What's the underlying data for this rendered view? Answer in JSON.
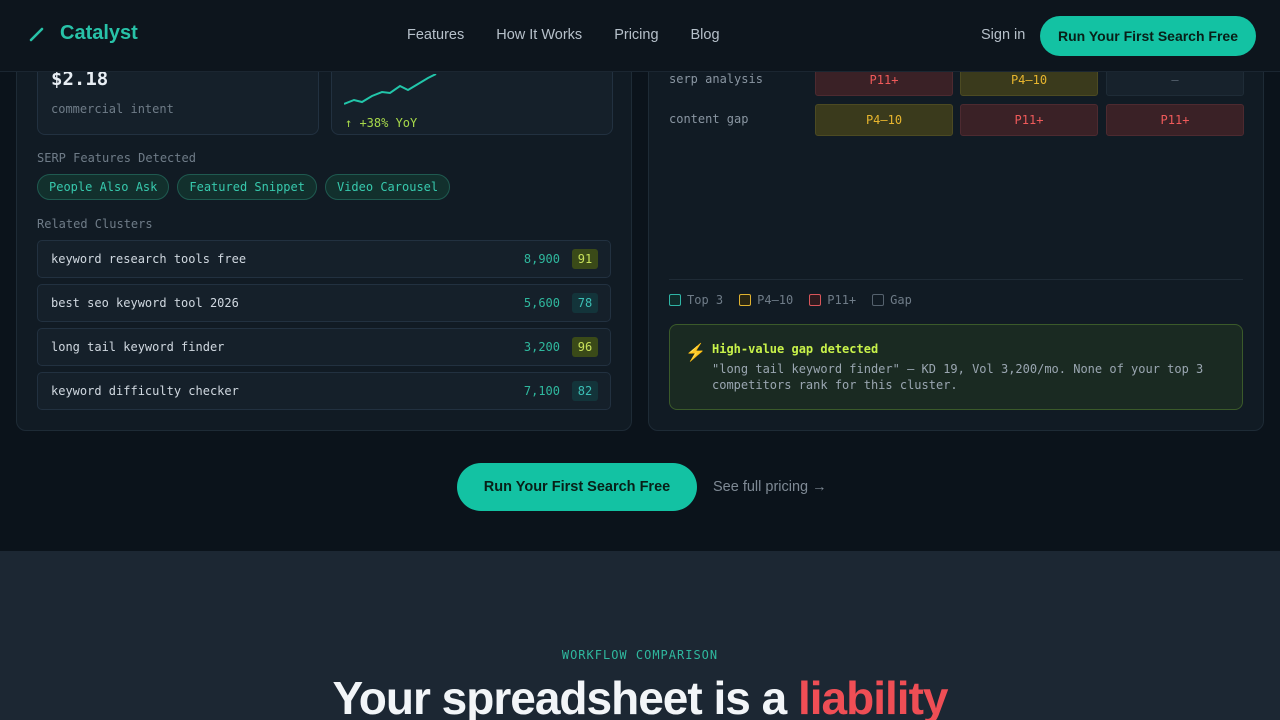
{
  "nav": {
    "brand": "Catalyst",
    "links": [
      "Features",
      "How It Works",
      "Pricing",
      "Blog"
    ],
    "signin": "Sign in",
    "cta": "Run Your First Search Free"
  },
  "metrics": {
    "cpc_value": "$2.18",
    "cpc_sub": "commercial intent",
    "trend_label": "↑ +38% YoY"
  },
  "serp": {
    "label": "SERP Features Detected",
    "features": [
      "People Also Ask",
      "Featured Snippet",
      "Video Carousel"
    ]
  },
  "clusters": {
    "label": "Related Clusters",
    "items": [
      {
        "name": "keyword research tools free",
        "volume": "8,900",
        "kd": "91"
      },
      {
        "name": "best seo keyword tool 2026",
        "volume": "5,600",
        "kd": "78"
      },
      {
        "name": "long tail keyword finder",
        "volume": "3,200",
        "kd": "96"
      },
      {
        "name": "keyword difficulty checker",
        "volume": "7,100",
        "kd": "82"
      }
    ]
  },
  "matrix": {
    "rows": [
      {
        "label": "serp analysis",
        "cells": [
          "P11+",
          "P4–10",
          "—"
        ]
      },
      {
        "label": "content gap",
        "cells": [
          "P4–10",
          "P11+",
          "P11+"
        ]
      }
    ],
    "legend": [
      "Top 3",
      "P4–10",
      "P11+",
      "Gap"
    ]
  },
  "alert": {
    "icon": "lightning-icon",
    "title": "High-value gap detected",
    "body": "\"long tail keyword finder\" — KD 19, Vol 3,200/mo. None of your top 3 competitors rank for this cluster."
  },
  "cta": {
    "primary": "Run Your First Search Free",
    "secondary": "See full pricing →"
  },
  "comparison": {
    "eyebrow": "WORKFLOW COMPARISON",
    "headline_main": "Your spreadsheet is a ",
    "headline_accent": "liability"
  },
  "colors": {
    "accent": "#13c2a3",
    "danger": "#ef4e55",
    "warning": "#e7b52e",
    "highlight": "#c8f24a"
  }
}
